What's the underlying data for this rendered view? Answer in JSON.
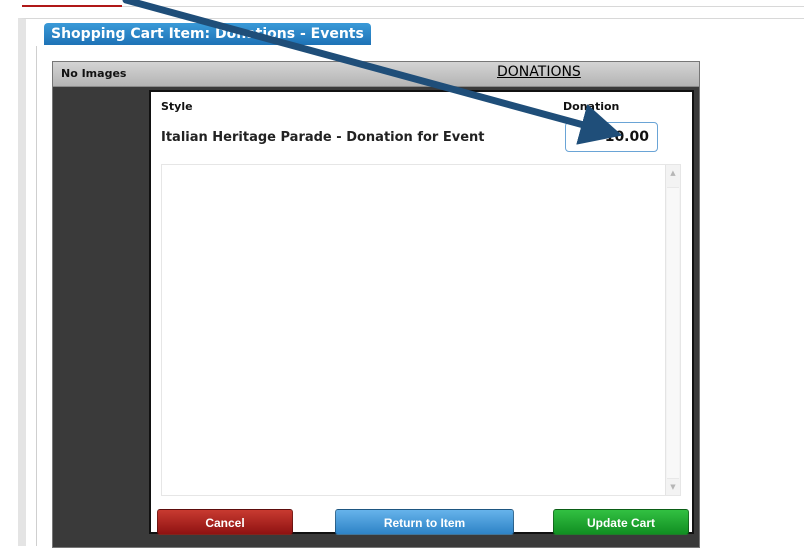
{
  "window": {
    "tab_title": "Shopping Cart Item: Donations - Events"
  },
  "dialog": {
    "no_images_label": "No Images",
    "header_title": "DONATIONS"
  },
  "item": {
    "style_header": "Style",
    "donation_header": "Donation",
    "name": "Italian Heritage Parade - Donation for Event",
    "donation_value": "10.00"
  },
  "scrollbar": {
    "up_icon": "▲",
    "down_icon": "▼"
  },
  "buttons": {
    "cancel": "Cancel",
    "return_to_item": "Return to Item",
    "update_cart": "Update Cart"
  },
  "colors": {
    "tab": "#1e72b6",
    "cancel": "#a61d1a",
    "return": "#3a8fd1",
    "update": "#1fa52d",
    "annotation_arrow": "#1f4e79"
  }
}
